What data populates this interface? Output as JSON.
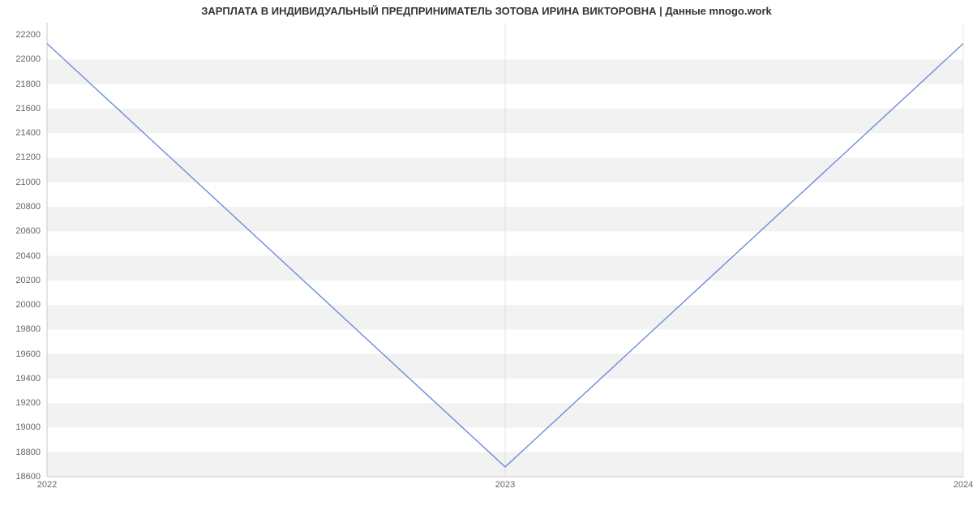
{
  "chart_data": {
    "type": "line",
    "title": "ЗАРПЛАТА В ИНДИВИДУАЛЬНЫЙ ПРЕДПРИНИМАТЕЛЬ ЗОТОВА ИРИНА ВИКТОРОВНА | Данные mnogo.work",
    "categories": [
      "2022",
      "2023",
      "2024"
    ],
    "values": [
      22130,
      18680,
      22130
    ],
    "xlabel": "",
    "ylabel": "",
    "ylim": [
      18600,
      22300
    ],
    "y_ticks": [
      18600,
      18800,
      19000,
      19200,
      19400,
      19600,
      19800,
      20000,
      20200,
      20400,
      20600,
      20800,
      21000,
      21200,
      21400,
      21600,
      21800,
      22000,
      22200
    ],
    "x_ticks": [
      "2022",
      "2023",
      "2024"
    ],
    "grid": true,
    "line_color": "#6b8fd4",
    "grid_color": "#f2f2f2",
    "axis_color": "#c9c9c9"
  }
}
